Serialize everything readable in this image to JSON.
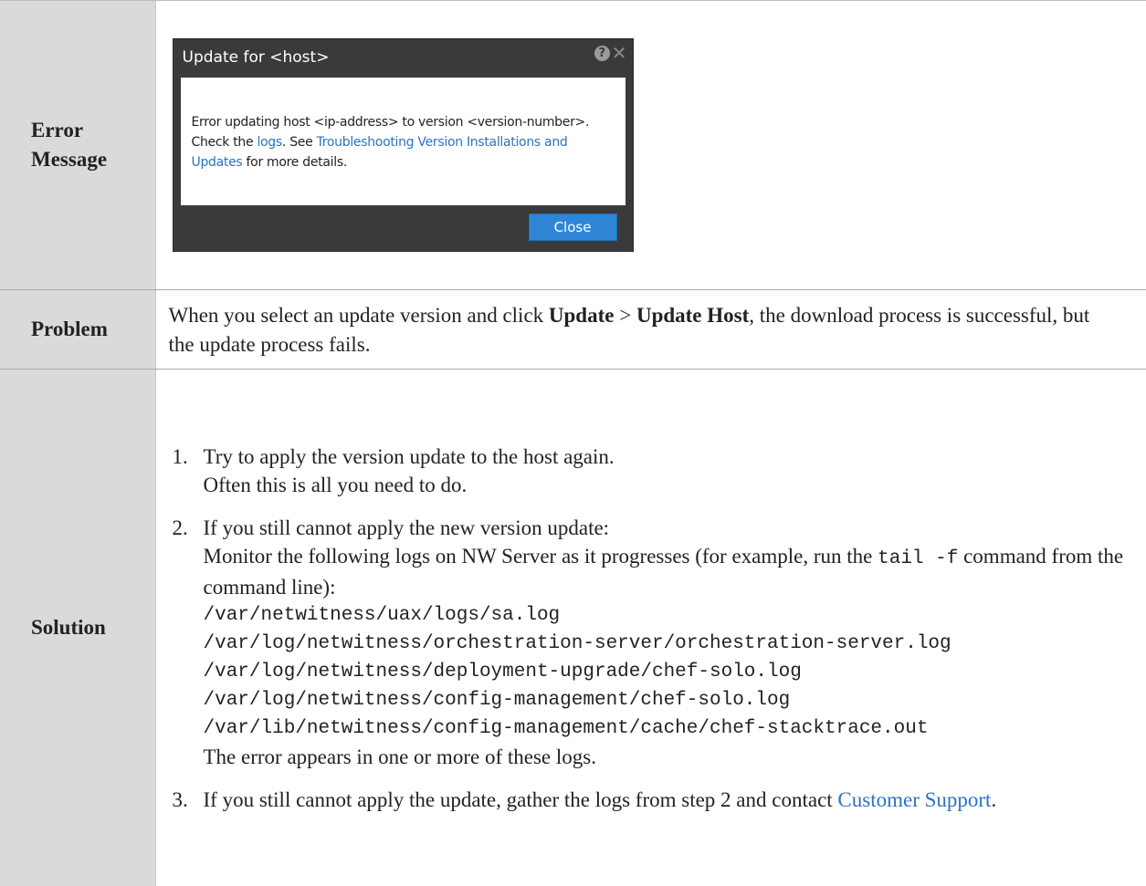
{
  "labels": {
    "error_line1": "Error",
    "error_line2": "Message",
    "problem": "Problem",
    "solution": "Solution"
  },
  "dialog": {
    "title": "Update for <host>",
    "help_glyph": "?",
    "close_glyph": "✕",
    "line1": "Error updating host <ip-address> to version <version-number>.",
    "line2_prefix": "Check the ",
    "line2_link": "logs",
    "line2_mid": ".  See ",
    "line2_link2": "Troubleshooting Version Installations and",
    "line3_link": "Updates",
    "line3_suffix": " for more details.",
    "close_button": "Close"
  },
  "problem": {
    "p1": "When you select an update version and click ",
    "b1": "Update",
    "p2": " > ",
    "b2": "Update Host",
    "p3": ", the download process is successful, but the update process fails."
  },
  "solution": {
    "step1": {
      "num": "1.",
      "line1": "Try to apply the version update to the host again.",
      "line2": "Often this is all you need to do."
    },
    "step2": {
      "num": "2.",
      "line1": "If you still cannot apply the new version update:",
      "line2_a": "Monitor the following logs on NW Server as it progresses (for example, run the ",
      "code": "tail -f",
      "line2_b": " command from the command line):",
      "paths": [
        "/var/netwitness/uax/logs/sa.log",
        "/var/log/netwitness/orchestration-server/orchestration-server.log",
        "/var/log/netwitness/deployment-upgrade/chef-solo.log",
        "/var/log/netwitness/config-management/chef-solo.log",
        "/var/lib/netwitness/config-management/cache/chef-stacktrace.out"
      ],
      "closing": "The error appears in one or more of these logs."
    },
    "step3": {
      "num": "3.",
      "text": "If you still cannot apply the update, gather the logs from step 2 and contact ",
      "link": "Customer Support",
      "end": "."
    }
  }
}
